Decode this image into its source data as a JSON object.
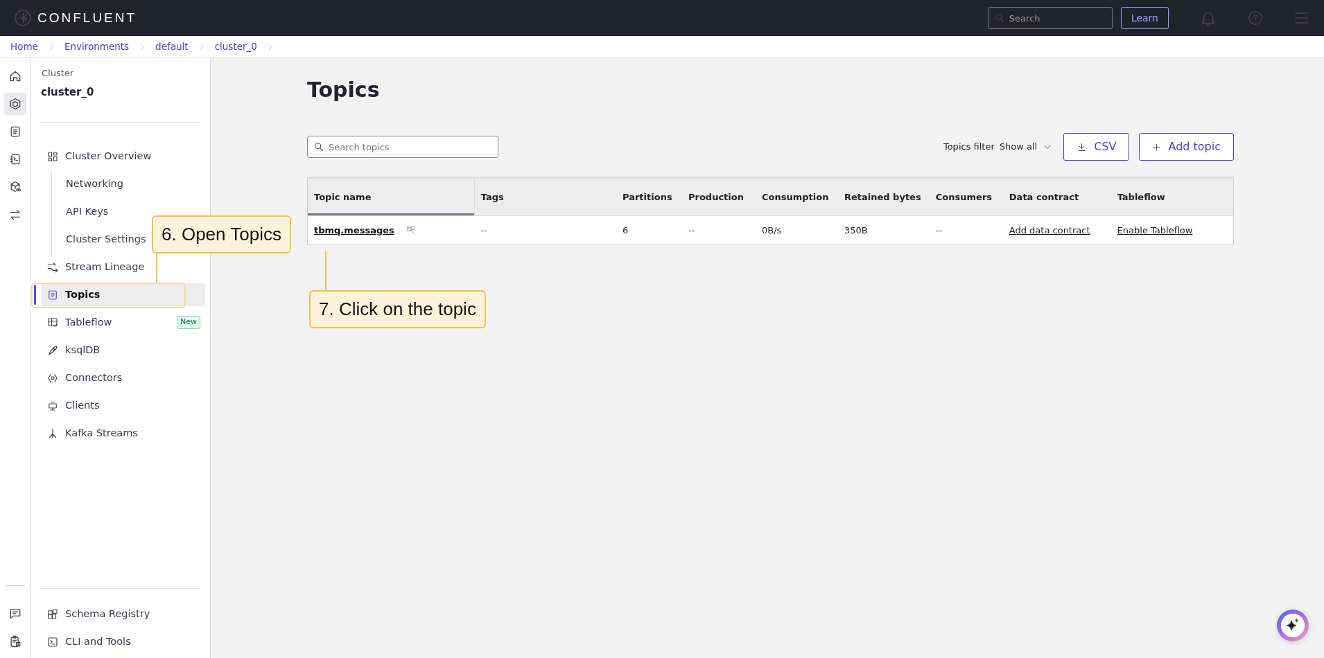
{
  "header": {
    "logo_text": "CONFLUENT",
    "search": {
      "placeholder": "Search"
    },
    "learn_button": "Learn"
  },
  "breadcrumbs": [
    "Home",
    "Environments",
    "default",
    "cluster_0"
  ],
  "rail": {
    "top_items": [
      {
        "selected": false
      },
      {
        "selected": true
      },
      {
        "selected": false
      },
      {
        "selected": false
      },
      {
        "selected": false
      },
      {
        "selected": false
      }
    ],
    "bottom_items": [
      {
        "selected": false
      },
      {
        "selected": false
      }
    ]
  },
  "sidebar": {
    "label": "Cluster",
    "cluster_name": "cluster_0",
    "items": [
      {
        "label": "Cluster Overview",
        "selected": false,
        "children": [
          {
            "label": "Networking",
            "selected": false
          },
          {
            "label": "API Keys",
            "selected": false
          },
          {
            "label": "Cluster Settings",
            "selected": false
          }
        ]
      },
      {
        "label": "Stream Lineage",
        "selected": false
      },
      {
        "label": "Topics",
        "selected": true
      },
      {
        "label": "Tableflow",
        "selected": false,
        "badge": "New"
      },
      {
        "label": "ksqlDB",
        "selected": false
      },
      {
        "label": "Connectors",
        "selected": false
      },
      {
        "label": "Clients",
        "selected": false
      },
      {
        "label": "Kafka Streams",
        "selected": false
      }
    ],
    "bottom_items": [
      {
        "label": "Schema Registry",
        "selected": false
      },
      {
        "label": "CLI and Tools",
        "selected": false
      }
    ]
  },
  "main": {
    "title": "Topics",
    "search": {
      "placeholder": "Search topics"
    },
    "filter": {
      "label": "Topics filter",
      "value": "Show all"
    },
    "buttons": [
      {
        "label": "CSV",
        "kind": "download"
      },
      {
        "label": "Add topic",
        "kind": "add"
      }
    ],
    "table": {
      "columns": [
        {
          "label": "Topic name",
          "sorted": true
        },
        {
          "label": "Tags",
          "sorted": false
        },
        {
          "label": "Partitions",
          "sorted": false
        },
        {
          "label": "Production",
          "sorted": false
        },
        {
          "label": "Consumption",
          "sorted": false
        },
        {
          "label": "Retained bytes",
          "sorted": false
        },
        {
          "label": "Consumers",
          "sorted": false
        },
        {
          "label": "Data contract",
          "sorted": false
        },
        {
          "label": "Tableflow",
          "sorted": false
        }
      ],
      "rows": [
        {
          "cells": [
            {
              "text": "tbmq.messages",
              "kind": "topic"
            },
            {
              "text": "--",
              "kind": "text"
            },
            {
              "text": "6",
              "kind": "text"
            },
            {
              "text": "--",
              "kind": "text"
            },
            {
              "text": "0B/s",
              "kind": "text"
            },
            {
              "text": "350B",
              "kind": "text"
            },
            {
              "text": "--",
              "kind": "text"
            },
            {
              "text": "Add data contract",
              "kind": "link"
            },
            {
              "text": "Enable Tableflow",
              "kind": "link"
            }
          ]
        }
      ]
    }
  },
  "annotations": [
    {
      "text": "6. Open Topics"
    },
    {
      "text": "7. Click on the topic"
    }
  ]
}
